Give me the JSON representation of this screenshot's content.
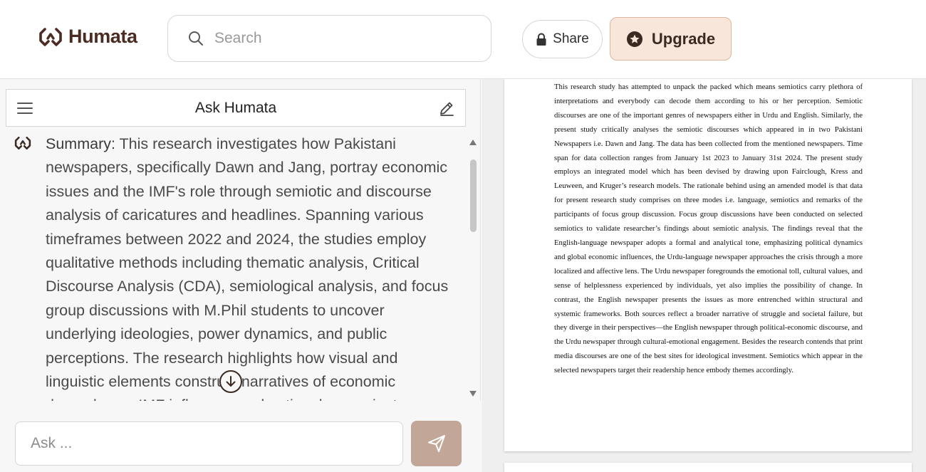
{
  "app": {
    "brand": "Humata"
  },
  "header": {
    "search_placeholder": "Search",
    "share_label": "Share",
    "upgrade_label": "Upgrade"
  },
  "chat": {
    "panel_title": "Ask Humata",
    "summary_label": "Summary:",
    "summary_text": " This research investigates how Pakistani newspapers, specifically Dawn and Jang, portray economic issues and the IMF's role through semiotic and discourse analysis of caricatures and headlines. Spanning various timeframes between 2022 and 2024, the studies employ qualitative methods including thematic analysis, Critical Discourse Analysis (CDA), semiological analysis, and focus group discussions with M.Phil students to uncover underlying ideologies, power dynamics, and public perceptions. The research highlights how visual and linguistic elements construct narratives of economic dependence, IMF influence, and national sovereignty.",
    "ask_placeholder": "Ask ..."
  },
  "document": {
    "paragraph": "This research study has attempted to unpack the packed which means semiotics carry plethora of interpretations and everybody can decode them according to his or her perception. Semiotic discourses are one of the important genres of newspapers either in Urdu and English. Similarly, the present study critically analyses the semiotic discourses which appeared in in two Pakistani Newspapers i.e. Dawn and Jang. The data has been collected from the mentioned newspapers. Time span for data collection ranges from January 1st 2023 to January 31st 2024. The present study employs an integrated model which has been devised by drawing upon Fairclough, Kress and Leuween, and Kruger’s research models. The rationale behind using an amended model is that data for present research study comprises on three modes i.e. language, semiotics and remarks of the participants of focus group discussion. Focus group discussions have been conducted on selected semiotics to validate researcher’s findings about semiotic analysis. The findings reveal that the English-language newspaper adopts a formal and analytical tone, emphasizing political dynamics and global economic influences, the Urdu-language newspaper approaches the crisis through a more localized and affective lens. The Urdu newspaper foregrounds the emotional toll, cultural values, and sense of helplessness experienced by individuals, yet also implies the possibility of change. In contrast, the English newspaper presents the issues as more entrenched within structural and systemic frameworks. Both sources reflect a broader narrative of struggle and societal failure, but they diverge in their perspectives—the English newspaper through political-economic discourse, and the Urdu newspaper through cultural-emotional engagement. Besides the research contends that print media discourses are one of the best sites for ideological investment. Semiotics which appear in the selected newspapers target their readership hence embody themes accordingly."
  },
  "icons": {
    "logo": "humata-logo-icon",
    "search": "search-icon",
    "share": "lock-icon",
    "upgrade": "star-badge-icon",
    "menu": "hamburger-menu-icon",
    "edit": "edit-pen-icon",
    "send": "send-icon",
    "jump": "arrow-down-circle-icon"
  },
  "colors": {
    "brand": "#4a2c22",
    "upgrade_bg": "#f7e6d9",
    "send_bg": "#c2a698"
  }
}
